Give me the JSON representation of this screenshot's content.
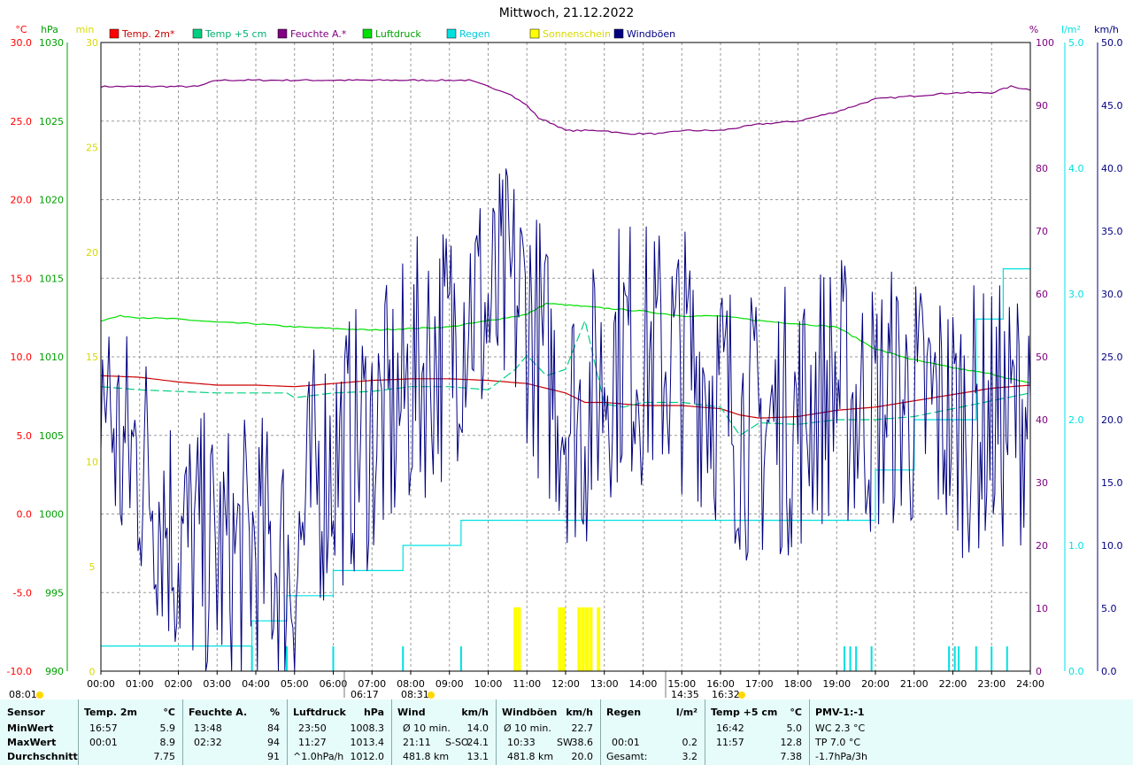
{
  "title": "Mittwoch, 21.12.2022",
  "axes": {
    "temp": {
      "unit": "°C",
      "ticks": [
        "30.0",
        "25.0",
        "20.0",
        "15.0",
        "10.0",
        "5.0",
        "0.0",
        "-5.0",
        "-10.0"
      ],
      "color": "#ff0000"
    },
    "pressure": {
      "unit": "hPa",
      "ticks": [
        "1030",
        "1025",
        "1020",
        "1015",
        "1010",
        "1005",
        "1000",
        "995",
        "990"
      ],
      "color": "#00a000"
    },
    "sun": {
      "unit": "min",
      "ticks": [
        "30",
        "25",
        "20",
        "15",
        "10",
        "5",
        "0"
      ],
      "color": "#d8d800"
    },
    "humidity": {
      "unit": "%",
      "ticks": [
        "100",
        "90",
        "80",
        "70",
        "60",
        "50",
        "40",
        "30",
        "20",
        "10",
        "0"
      ],
      "color": "#800080"
    },
    "rain": {
      "unit": "l/m²",
      "ticks": [
        "5.0",
        "4.0",
        "3.0",
        "2.0",
        "1.0",
        "0.0"
      ],
      "color": "#00e0e0"
    },
    "wind": {
      "unit": "km/h",
      "ticks": [
        "50.0",
        "45.0",
        "40.0",
        "35.0",
        "30.0",
        "25.0",
        "20.0",
        "15.0",
        "10.0",
        "5.0",
        "0.0"
      ],
      "color": "#000080"
    },
    "time_ticks": [
      "00:00",
      "01:00",
      "02:00",
      "03:00",
      "04:00",
      "05:00",
      "06:00",
      "07:00",
      "08:00",
      "09:00",
      "10:00",
      "11:00",
      "12:00",
      "13:00",
      "14:00",
      "15:00",
      "16:00",
      "17:00",
      "18:00",
      "19:00",
      "20:00",
      "21:00",
      "22:00",
      "23:00",
      "24:00"
    ]
  },
  "legend": [
    {
      "label": "Temp. 2m*",
      "color": "#ff0000"
    },
    {
      "label": "Temp +5 cm",
      "color": "#00d080"
    },
    {
      "label": "Feuchte A.*",
      "color": "#800080"
    },
    {
      "label": "Luftdruck",
      "color": "#00e000"
    },
    {
      "label": "Regen",
      "color": "#00e0e0"
    },
    {
      "label": "Sonnenschein",
      "color": "#ffff00"
    },
    {
      "label": "Windböen",
      "color": "#000080"
    }
  ],
  "sun_events": {
    "left_time": "08:01",
    "sunrise": "06:17",
    "sun_a": "08:31",
    "sun_b": "14:35",
    "sunset": "16:32"
  },
  "chart_data": {
    "type": "line",
    "x_unit": "hour",
    "xlim": [
      0,
      24
    ],
    "series": [
      {
        "name": "Temp. 2m*",
        "axis": "temp",
        "color": "#cc0000",
        "x": [
          0,
          1,
          2,
          3,
          4,
          5,
          6,
          7,
          8,
          8.5,
          9,
          10,
          11,
          12,
          12.5,
          13,
          14,
          15,
          16,
          16.5,
          17,
          18,
          19,
          20,
          21,
          22,
          23,
          24
        ],
        "y": [
          8.8,
          8.7,
          8.4,
          8.2,
          8.2,
          8.1,
          8.3,
          8.5,
          8.6,
          8.6,
          8.6,
          8.5,
          8.3,
          7.7,
          7.1,
          7.1,
          6.9,
          6.9,
          6.7,
          6.3,
          6.1,
          6.2,
          6.6,
          6.8,
          7.2,
          7.6,
          8.0,
          8.2
        ]
      },
      {
        "name": "Temp +5 cm",
        "axis": "temp",
        "color": "#00d080",
        "dashed": true,
        "x": [
          0,
          1,
          2,
          3,
          4,
          4.8,
          5,
          6,
          7,
          8,
          9,
          10,
          10.7,
          11,
          11.5,
          12,
          12.5,
          13,
          13.5,
          14,
          15,
          16,
          16.5,
          17,
          18,
          19,
          20,
          21,
          22,
          23,
          24
        ],
        "y": [
          8.1,
          7.9,
          7.8,
          7.7,
          7.7,
          7.7,
          7.4,
          7.7,
          7.8,
          8.1,
          8.1,
          7.9,
          9.2,
          10.1,
          8.8,
          9.2,
          12.3,
          7.0,
          6.8,
          7.1,
          7.1,
          6.8,
          5.0,
          5.8,
          5.7,
          6.0,
          6.0,
          6.2,
          6.7,
          7.2,
          7.7
        ]
      },
      {
        "name": "Feuchte A.*",
        "axis": "humidity",
        "color": "#800080",
        "x": [
          0,
          1,
          2,
          2.5,
          3,
          4,
          5,
          6,
          7,
          8,
          9,
          9.5,
          10,
          10.5,
          11,
          11.3,
          11.7,
          12,
          12.5,
          13,
          13.5,
          14,
          14.5,
          15,
          16,
          16.5,
          17,
          18,
          19,
          20,
          21,
          22,
          23,
          23.5,
          24
        ],
        "y": [
          93,
          93,
          93,
          93,
          94,
          94,
          94,
          94,
          94,
          94,
          94,
          94,
          93,
          92,
          90,
          88,
          87,
          86,
          86,
          86,
          85.5,
          85.5,
          85.5,
          86,
          86,
          86.5,
          87,
          87.5,
          89,
          91,
          91.5,
          92,
          92,
          93,
          92.5
        ]
      },
      {
        "name": "Luftdruck",
        "axis": "pressure",
        "color": "#00e000",
        "x": [
          0,
          0.5,
          1,
          2,
          3,
          4,
          5,
          6,
          7,
          8,
          9,
          10,
          11,
          11.5,
          12,
          13,
          14,
          15,
          16,
          17,
          18,
          19,
          20,
          21,
          22,
          23,
          24
        ],
        "y": [
          1012.3,
          1012.6,
          1012.5,
          1012.4,
          1012.2,
          1012.1,
          1011.9,
          1011.8,
          1011.7,
          1011.8,
          1011.9,
          1012.3,
          1012.7,
          1013.4,
          1013.3,
          1013.1,
          1012.9,
          1012.6,
          1012.6,
          1012.3,
          1012.1,
          1011.9,
          1010.5,
          1009.8,
          1009.3,
          1008.9,
          1008.3
        ]
      },
      {
        "name": "Regen",
        "axis": "rain",
        "color": "#00e0e0",
        "step": true,
        "x": [
          0,
          3.9,
          4.8,
          6.0,
          7.8,
          9.3,
          10,
          16,
          17,
          19.2,
          20,
          21,
          22.6,
          23.3,
          23.6,
          24
        ],
        "y": [
          0.2,
          0.4,
          0.6,
          0.8,
          1.0,
          1.2,
          1.2,
          1.2,
          1.2,
          1.2,
          1.6,
          2.0,
          2.8,
          3.2,
          3.2,
          3.2
        ]
      },
      {
        "name": "Windböen",
        "axis": "wind",
        "color": "#000080",
        "gusty": true,
        "x": [
          0,
          0.5,
          1,
          1.5,
          2,
          2.5,
          3,
          3.5,
          4,
          4.5,
          5,
          5.5,
          6,
          6.5,
          7,
          7.5,
          8,
          8.5,
          9,
          9.5,
          10,
          10.5,
          11,
          11.5,
          12,
          12.5,
          13,
          13.5,
          14,
          14.5,
          15,
          15.5,
          16,
          16.5,
          17,
          17.5,
          18,
          18.5,
          19,
          19.5,
          20,
          20.5,
          21,
          21.5,
          22,
          22.5,
          23,
          23.5,
          24
        ],
        "y": [
          24,
          17,
          17,
          14,
          10,
          10,
          9,
          9,
          10,
          9,
          8,
          15,
          17,
          18,
          19,
          20,
          23,
          25,
          26,
          30,
          28,
          30,
          29,
          24,
          21,
          20,
          24,
          26,
          25,
          25,
          25,
          24,
          22,
          20,
          19,
          20,
          20,
          22,
          23,
          21,
          21,
          22,
          21,
          21,
          20,
          20,
          20,
          20,
          22
        ]
      }
    ],
    "sunshine_minutes": [
      {
        "x": 10.7,
        "y": 2
      },
      {
        "x": 10.8,
        "y": 2
      },
      {
        "x": 11.85,
        "y": 2
      },
      {
        "x": 11.95,
        "y": 2
      },
      {
        "x": 12.35,
        "y": 2
      },
      {
        "x": 12.45,
        "y": 2
      },
      {
        "x": 12.55,
        "y": 2
      },
      {
        "x": 12.65,
        "y": 2
      },
      {
        "x": 12.85,
        "y": 2
      }
    ],
    "rain_events": [
      3.9,
      4.8,
      6.0,
      7.8,
      9.3,
      19.2,
      19.35,
      19.5,
      19.9,
      21.9,
      22.05,
      22.15,
      22.6,
      23.0,
      23.4
    ]
  },
  "stats": {
    "sensor": {
      "header": "Sensor",
      "rows": [
        "MinWert",
        "MaxWert",
        "Durchschnitt"
      ]
    },
    "temp2m": {
      "header": "Temp. 2m",
      "unit": "°C",
      "rows": [
        [
          "16:57",
          "5.9"
        ],
        [
          "00:01",
          "8.9"
        ],
        [
          "",
          "7.75"
        ]
      ]
    },
    "humidity": {
      "header": "Feuchte A.",
      "unit": "%",
      "rows": [
        [
          "13:48",
          "84"
        ],
        [
          "02:32",
          "94"
        ],
        [
          "",
          "91"
        ]
      ]
    },
    "pressure": {
      "header": "Luftdruck",
      "unit": "hPa",
      "rows": [
        [
          "23:50",
          "1008.3"
        ],
        [
          "11:27",
          "1013.4"
        ],
        [
          "^1.0hPa/h",
          "1012.0"
        ]
      ]
    },
    "wind": {
      "header": "Wind",
      "unit": "km/h",
      "rows": [
        [
          "Ø 10 min.",
          "",
          "14.0"
        ],
        [
          "21:11",
          "S-SO",
          "24.1"
        ],
        [
          "481.8 km",
          "",
          "13.1"
        ]
      ]
    },
    "gusts": {
      "header": "Windböen",
      "unit": "km/h",
      "rows": [
        [
          "Ø 10 min.",
          "",
          "22.7"
        ],
        [
          "10:33",
          "SW",
          "38.6"
        ],
        [
          "481.8 km",
          "",
          "20.0"
        ]
      ]
    },
    "rain": {
      "header": "Regen",
      "unit": "l/m²",
      "rows": [
        [
          "",
          ""
        ],
        [
          "00:01",
          "0.2"
        ],
        [
          "Gesamt:",
          "3.2"
        ]
      ]
    },
    "temp5cm": {
      "header": "Temp +5 cm",
      "unit": "°C",
      "rows": [
        [
          "16:42",
          "5.0"
        ],
        [
          "11:57",
          "12.8"
        ],
        [
          "",
          "7.38"
        ]
      ]
    },
    "pmv": {
      "header": "PMV-1:-1",
      "rows": [
        "WC 2.3 °C",
        "TP 7.0 °C",
        "-1.7hPa/3h"
      ]
    }
  }
}
